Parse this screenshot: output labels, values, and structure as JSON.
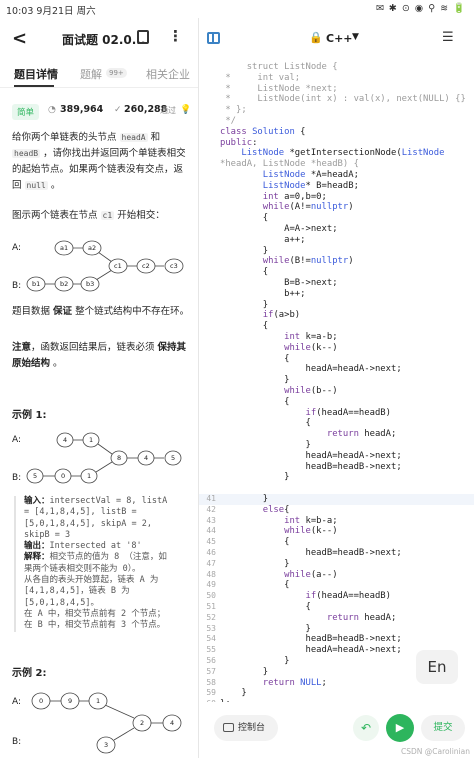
{
  "status_bar": {
    "time": "10:03",
    "date": "9月21日 周六",
    "indicators": "✉ ✱ ⊙ ◉ ⚲ ≋ 🔋"
  },
  "header": {
    "title": "面试题 02.0..."
  },
  "tabs": [
    {
      "label": "题目详情"
    },
    {
      "label": "题解",
      "badge": "99+"
    },
    {
      "label": "相关企业"
    }
  ],
  "meta": {
    "difficulty": "简单",
    "views": "389,964",
    "views_label": "",
    "passed": "260,288",
    "passed_label": "通过"
  },
  "problem": {
    "p1_a": "给你两个单链表的头节点 ",
    "headA": "headA",
    "p1_b": " 和 ",
    "headB": "headB",
    "p1_c": " ，请你找出并返回两个单链表相交的起始节点。如果两个链表没有交点，返回 ",
    "null": "null",
    "p1_d": " 。",
    "p2_a": "图示两个链表在节点 ",
    "c1": "c1",
    "p2_b": " 开始相交：",
    "p3_a": "题目数据 ",
    "p3_b": "保证",
    "p3_c": " 整个链式结构中不存在环。",
    "p4_a": "注意",
    "p4_b": "，函数返回结果后，链表必须 ",
    "p4_c": "保持其原始结构",
    "p4_d": " 。"
  },
  "diagram1": {
    "labelA": "A:",
    "labelB": "B:",
    "a_nodes": [
      "a1",
      "a2"
    ],
    "b_nodes": [
      "b1",
      "b2",
      "b3"
    ],
    "c_nodes": [
      "c1",
      "c2",
      "c3"
    ]
  },
  "example1": {
    "title": "示例 1:",
    "labelA": "A:",
    "labelB": "B:",
    "a_nodes": [
      "4",
      "1"
    ],
    "b_nodes": [
      "5",
      "0",
      "1"
    ],
    "c_nodes": [
      "8",
      "4",
      "5"
    ],
    "input_label": "输入：",
    "input_lines": [
      "intersectVal = 8, listA",
      "= [4,1,8,4,5], listB =",
      "[5,0,1,8,4,5], skipA = 2,",
      "skipB = 3"
    ],
    "output_label": "输出：",
    "output": "Intersected at '8'",
    "explain_label": "解释：",
    "explain_lines": [
      "相交节点的值为 8 （注意，如",
      "果两个链表相交则不能为 0）。",
      "从各自的表头开始算起，链表 A 为",
      "[4,1,8,4,5]，链表 B 为",
      "[5,0,1,8,4,5]。",
      "在 A 中，相交节点前有 2 个节点；",
      "在 B 中，相交节点前有 3 个节点。"
    ]
  },
  "example2": {
    "title": "示例 2:",
    "labelA": "A:",
    "labelB": "B:",
    "a_nodes": [
      "0",
      "9",
      "1"
    ],
    "c_nodes": [
      "2",
      "4"
    ],
    "b_nodes": [
      "3"
    ]
  },
  "editor": {
    "language": "C++",
    "lines": [
      {
        "n": "",
        "t": "     struct ListNode {"
      },
      {
        "n": "",
        "t": " *     int val;"
      },
      {
        "n": "",
        "t": " *     ListNode *next;"
      },
      {
        "n": "",
        "t": " *     ListNode(int x) : val(x), next(NULL) {}"
      },
      {
        "n": "",
        "t": " * };"
      },
      {
        "n": "",
        "t": " */"
      },
      {
        "n": "",
        "t": "class Solution {"
      },
      {
        "n": "",
        "t": "public:"
      },
      {
        "n": "",
        "t": "    ListNode *getIntersectionNode(ListNode"
      },
      {
        "n": "",
        "t": "*headA, ListNode *headB) {"
      },
      {
        "n": "",
        "t": "        ListNode *A=headA;"
      },
      {
        "n": "",
        "t": "        ListNode* B=headB;"
      },
      {
        "n": "",
        "t": "        int a=0,b=0;"
      },
      {
        "n": "",
        "t": "        while(A!=nullptr)"
      },
      {
        "n": "",
        "t": "        {"
      },
      {
        "n": "",
        "t": "            A=A->next;"
      },
      {
        "n": "",
        "t": "            a++;"
      },
      {
        "n": "",
        "t": "        }"
      },
      {
        "n": "",
        "t": "        while(B!=nullptr)"
      },
      {
        "n": "",
        "t": "        {"
      },
      {
        "n": "",
        "t": "            B=B->next;"
      },
      {
        "n": "",
        "t": "            b++;"
      },
      {
        "n": "",
        "t": "        }"
      },
      {
        "n": "",
        "t": "        if(a>b)"
      },
      {
        "n": "",
        "t": "        {"
      },
      {
        "n": "",
        "t": "            int k=a-b;"
      },
      {
        "n": "",
        "t": "            while(k--)"
      },
      {
        "n": "",
        "t": "            {"
      },
      {
        "n": "",
        "t": "                headA=headA->next;"
      },
      {
        "n": "",
        "t": "            }"
      },
      {
        "n": "",
        "t": "            while(b--)"
      },
      {
        "n": "",
        "t": "            {"
      },
      {
        "n": "",
        "t": "                if(headA==headB)"
      },
      {
        "n": "",
        "t": "                {"
      },
      {
        "n": "",
        "t": "                    return headA;"
      },
      {
        "n": "",
        "t": "                }"
      },
      {
        "n": "",
        "t": "                headA=headA->next;"
      },
      {
        "n": "",
        "t": "                headB=headB->next;"
      },
      {
        "n": "",
        "t": "            }"
      },
      {
        "n": "",
        "t": ""
      },
      {
        "n": "41",
        "t": "        }"
      },
      {
        "n": "42",
        "t": "        else{"
      },
      {
        "n": "43",
        "t": "            int k=b-a;"
      },
      {
        "n": "44",
        "t": "            while(k--)"
      },
      {
        "n": "45",
        "t": "            {"
      },
      {
        "n": "46",
        "t": "                headB=headB->next;"
      },
      {
        "n": "47",
        "t": "            }"
      },
      {
        "n": "48",
        "t": "            while(a--)"
      },
      {
        "n": "49",
        "t": "            {"
      },
      {
        "n": "50",
        "t": "                if(headA==headB)"
      },
      {
        "n": "51",
        "t": "                {"
      },
      {
        "n": "52",
        "t": "                    return headA;"
      },
      {
        "n": "53",
        "t": "                }"
      },
      {
        "n": "54",
        "t": "                headB=headB->next;"
      },
      {
        "n": "55",
        "t": "                headA=headA->next;"
      },
      {
        "n": "56",
        "t": "            }"
      },
      {
        "n": "57",
        "t": "        }"
      },
      {
        "n": "58",
        "t": "        return NULL;"
      },
      {
        "n": "59",
        "t": "    }"
      },
      {
        "n": "60",
        "t": "};"
      }
    ]
  },
  "ime_button": "En",
  "bottom": {
    "console": "控制台",
    "submit": "提交"
  },
  "watermark": "CSDN @Carolinian",
  "colors": {
    "accent_green": "#2db55d",
    "keyword": "#7a3e9d",
    "type": "#3b5bdb",
    "line_highlight": "#f1f5fb"
  }
}
